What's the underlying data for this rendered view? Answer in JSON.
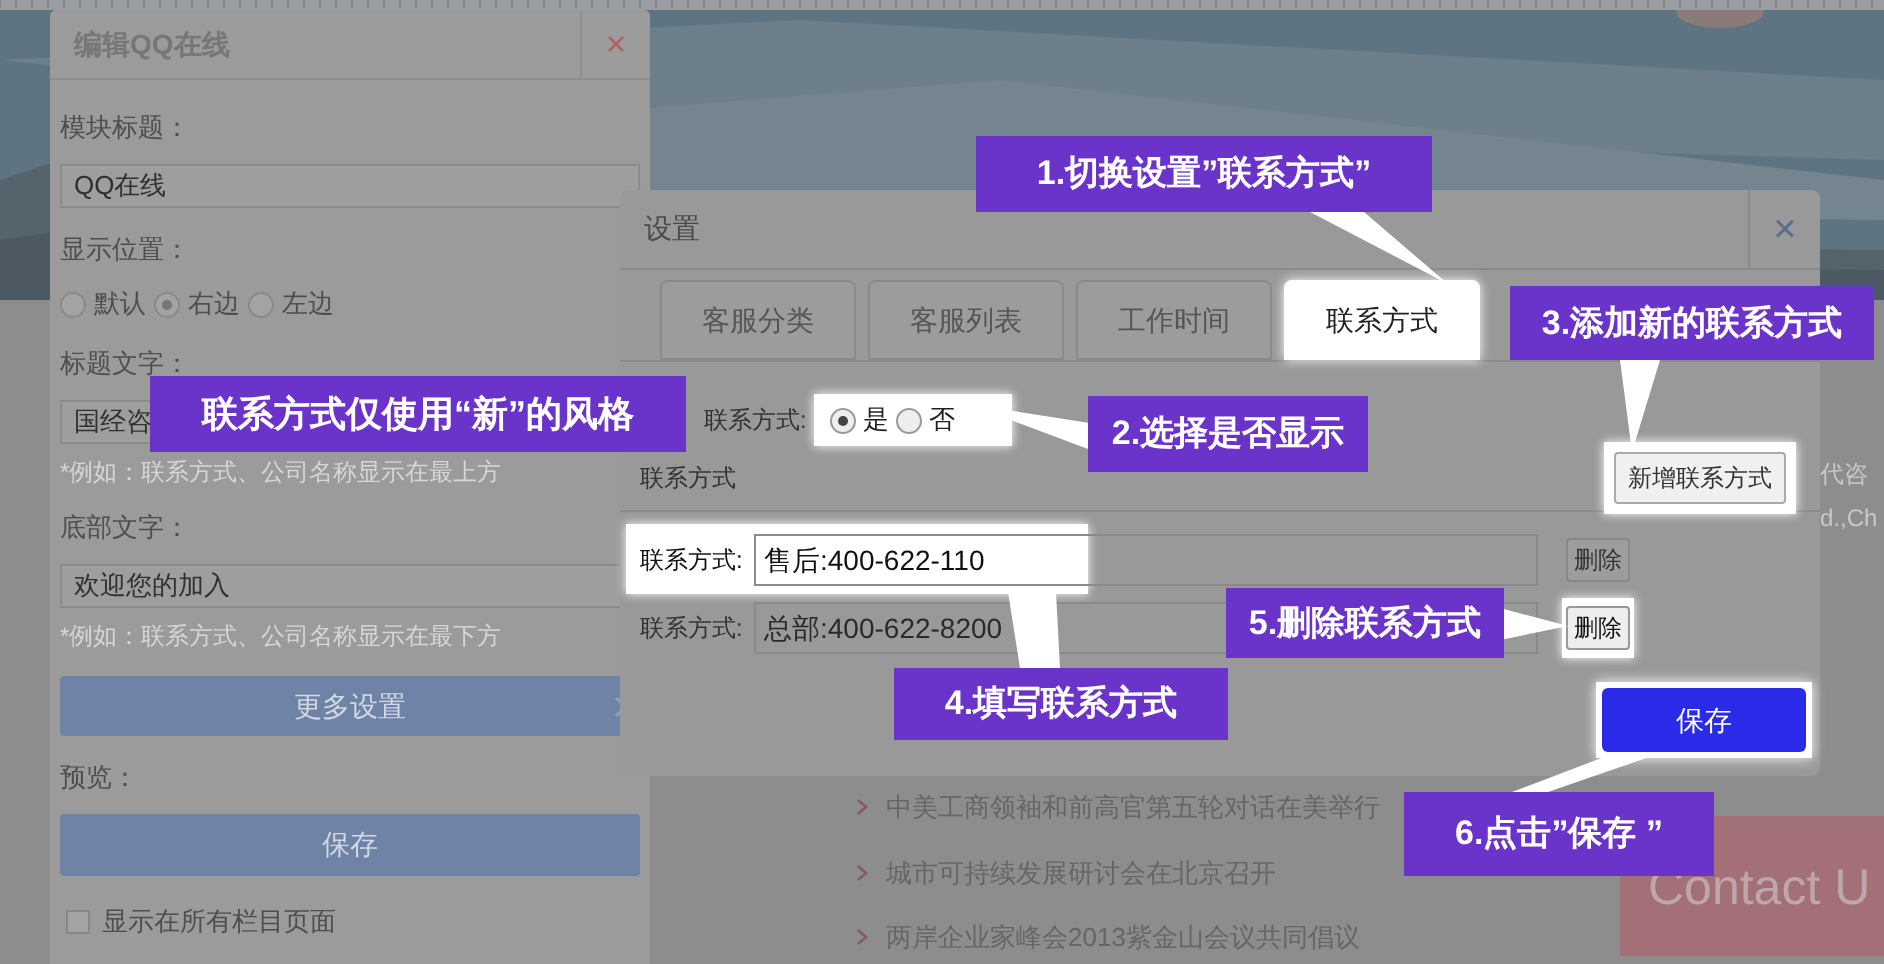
{
  "page": {
    "banner": {
      "kind": "picture"
    },
    "edge_texts": [
      "代咨",
      "d.,Ch"
    ],
    "news": [
      {
        "text": "中美工商领袖和前高官第五轮对话在美举行"
      },
      {
        "text": "城市可持续发展研讨会在北京召开"
      },
      {
        "text": "两岸企业家峰会2013紫金山会议共同倡议"
      }
    ],
    "contact_box": "Contact U"
  },
  "edit_panel": {
    "title": "编辑QQ在线",
    "close": "×",
    "items": [
      {
        "kind": "label",
        "text": "模块标题："
      },
      {
        "kind": "input",
        "value": "QQ在线"
      },
      {
        "kind": "label",
        "text": "显示位置："
      },
      {
        "kind": "radios",
        "options": [
          {
            "label": "默认",
            "selected": false
          },
          {
            "label": "右边",
            "selected": true
          },
          {
            "label": "左边",
            "selected": false
          }
        ]
      },
      {
        "kind": "label",
        "text": "标题文字："
      },
      {
        "kind": "input",
        "value": "国经咨"
      },
      {
        "kind": "hint",
        "text": "*例如：联系方式、公司名称显示在最上方"
      },
      {
        "kind": "label",
        "text": "底部文字："
      },
      {
        "kind": "input",
        "value": "欢迎您的加入"
      },
      {
        "kind": "hint",
        "text": "*例如：联系方式、公司名称显示在最下方"
      },
      {
        "kind": "more_button",
        "text": "更多设置"
      },
      {
        "kind": "label",
        "text": "预览："
      },
      {
        "kind": "button",
        "text": "保存"
      },
      {
        "kind": "checkbox",
        "text": "显示在所有栏目页面",
        "checked": false
      }
    ]
  },
  "settings_dialog": {
    "title": "设置",
    "close": "×",
    "tabs": [
      {
        "label": "客服分类",
        "selected": false
      },
      {
        "label": "客服列表",
        "selected": false
      },
      {
        "label": "工作时间",
        "selected": false
      },
      {
        "label": "联系方式",
        "selected": true
      }
    ],
    "display": {
      "label": "联系方式:",
      "options": [
        {
          "label": "是",
          "selected": true
        },
        {
          "label": "否",
          "selected": false
        }
      ]
    },
    "section_title": "联系方式",
    "add_button": "新增联系方式",
    "rows": [
      {
        "label": "联系方式:",
        "value": "售后:400-622-110",
        "delete": "删除"
      },
      {
        "label": "联系方式:",
        "value": "总部:400-622-8200",
        "delete": "删除"
      }
    ],
    "save": "保存"
  },
  "callouts": [
    {
      "text": "联系方式仅使用“新”的风格"
    },
    {
      "text": "1.切换设置”联系方式”"
    },
    {
      "text": "2.选择是否显示"
    },
    {
      "text": "3.添加新的联系方式"
    },
    {
      "text": "4.填写联系方式"
    },
    {
      "text": "5.删除联系方式"
    },
    {
      "text": "6.点击”保存 ”"
    }
  ]
}
